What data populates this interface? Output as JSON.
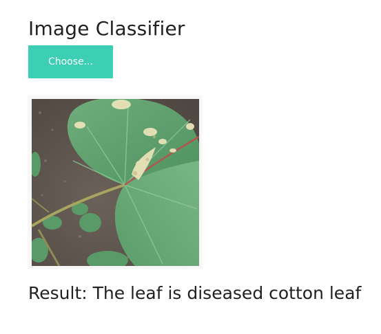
{
  "page": {
    "title": "Image Classifier"
  },
  "upload": {
    "button_label": "Choose...",
    "accent_color": "#3ccfb3"
  },
  "preview": {
    "image_subject": "cotton-leaf-photo"
  },
  "result": {
    "text": "Result: The leaf is diseased cotton leaf"
  }
}
